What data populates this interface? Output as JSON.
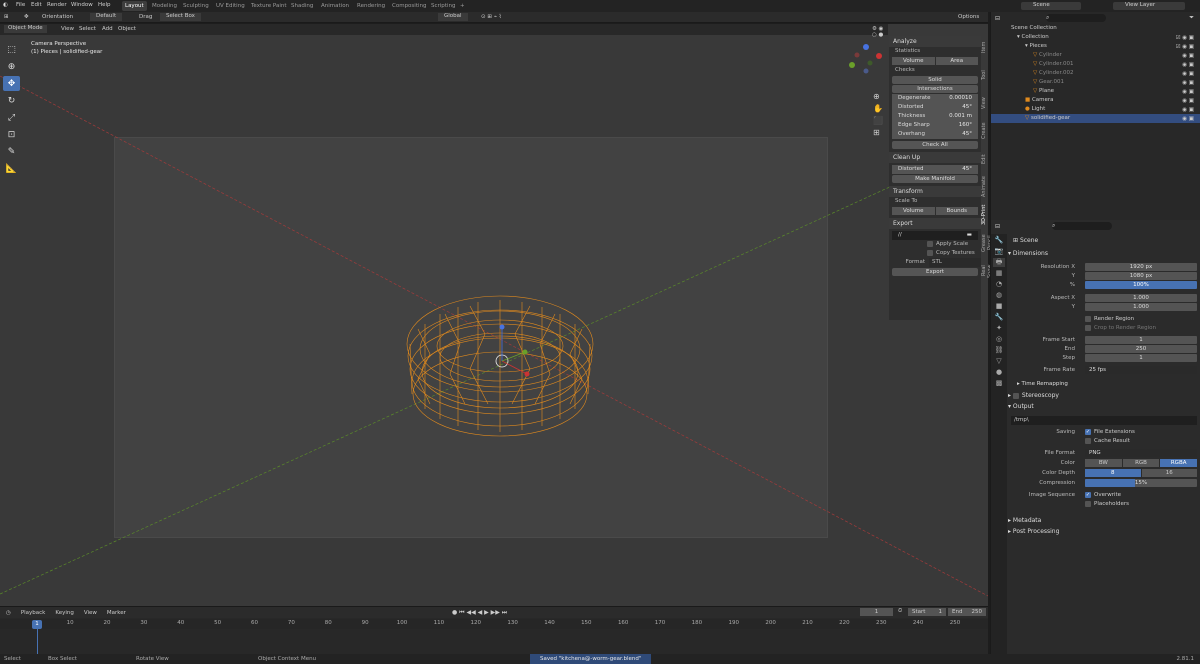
{
  "menu": {
    "file": "File",
    "edit": "Edit",
    "render": "Render",
    "window": "Window",
    "help": "Help"
  },
  "workspaces": [
    "Layout",
    "Modeling",
    "Sculpting",
    "UV Editing",
    "Texture Paint",
    "Shading",
    "Animation",
    "Rendering",
    "Compositing",
    "Scripting"
  ],
  "add_tab": "+",
  "scene": {
    "label": "Scene",
    "view_layer": "View Layer"
  },
  "header": {
    "orientation_label": "Orientation",
    "orientation_value": "Default",
    "drag_label": "Drag",
    "drag_value": "Select Box",
    "transform_orient": "Global",
    "options": "Options"
  },
  "vp_header": {
    "mode": "Object Mode",
    "view": "View",
    "select": "Select",
    "add": "Add",
    "object": "Object"
  },
  "viewport": {
    "camera_text": "Camera Perspective",
    "object_text": "(1) Pieces | solidified-gear"
  },
  "npanel": {
    "analyze": "Analyze",
    "statistics": "Statistics",
    "volume": "Volume",
    "area": "Area",
    "checks": "Checks",
    "solid": "Solid",
    "intersections": "Intersections",
    "rows": [
      {
        "label": "Degenerate",
        "value": "0.00010"
      },
      {
        "label": "Distorted",
        "value": "45°"
      },
      {
        "label": "Thickness",
        "value": "0.001 m"
      },
      {
        "label": "Edge Sharp",
        "value": "160°"
      },
      {
        "label": "Overhang",
        "value": "45°"
      }
    ],
    "check_all": "Check All",
    "cleanup": "Clean Up",
    "distorted": "Distorted",
    "distorted_val": "45°",
    "make_manifold": "Make Manifold",
    "transform": "Transform",
    "scale_to": "Scale To",
    "t_volume": "Volume",
    "bounds": "Bounds",
    "export": "Export",
    "export_path": "//",
    "apply_scale": "Apply Scale",
    "copy_textures": "Copy Textures",
    "format_label": "Format",
    "format_value": "STL",
    "export_btn": "Export"
  },
  "side_tabs": [
    "Item",
    "Tool",
    "View",
    "Create",
    "Edit",
    "Animate",
    "3D-Print",
    "Grease Pencil",
    "Real Snow"
  ],
  "outliner": {
    "scene_collection": "Scene Collection",
    "items": [
      {
        "name": "Collection",
        "indent": 1
      },
      {
        "name": "Pieces",
        "indent": 2
      },
      {
        "name": "Cylinder",
        "indent": 3,
        "dim": true
      },
      {
        "name": "Cylinder.001",
        "indent": 3,
        "dim": true
      },
      {
        "name": "Cylinder.002",
        "indent": 3,
        "dim": true
      },
      {
        "name": "Gear.001",
        "indent": 3,
        "dim": true
      },
      {
        "name": "Plane",
        "indent": 3
      },
      {
        "name": "Camera",
        "indent": 2
      },
      {
        "name": "Light",
        "indent": 2
      },
      {
        "name": "solidified-gear",
        "indent": 2,
        "selected": true
      }
    ]
  },
  "props": {
    "scene": "Scene",
    "dimensions": "Dimensions",
    "res_x_label": "Resolution X",
    "res_x": "1920 px",
    "res_y_label": "Y",
    "res_y": "1080 px",
    "res_pct_label": "%",
    "res_pct": "100%",
    "aspect_x_label": "Aspect X",
    "aspect_x": "1.000",
    "aspect_y_label": "Y",
    "aspect_y": "1.000",
    "render_region": "Render Region",
    "crop_region": "Crop to Render Region",
    "frame_start_label": "Frame Start",
    "frame_start": "1",
    "frame_end_label": "End",
    "frame_end": "250",
    "frame_step_label": "Step",
    "frame_step": "1",
    "frame_rate_label": "Frame Rate",
    "frame_rate": "25 fps",
    "time_remapping": "Time Remapping",
    "stereoscopy": "Stereoscopy",
    "output": "Output",
    "output_path": "/tmp\\",
    "saving": "Saving",
    "file_ext": "File Extensions",
    "cache_result": "Cache Result",
    "file_format_label": "File Format",
    "file_format": "PNG",
    "color_label": "Color",
    "bw": "BW",
    "rgb": "RGB",
    "rgba": "RGBA",
    "color_depth_label": "Color Depth",
    "depth8": "8",
    "depth16": "16",
    "compression_label": "Compression",
    "compression": "15%",
    "compression_fill": 0.15,
    "img_seq": "Image Sequence",
    "overwrite": "Overwrite",
    "placeholders": "Placeholders",
    "metadata": "Metadata",
    "post_processing": "Post Processing"
  },
  "timeline": {
    "playback": "Playback",
    "keying": "Keying",
    "view": "View",
    "marker": "Marker",
    "current": "1",
    "start_label": "Start",
    "start": "1",
    "end_label": "End",
    "end": "250",
    "ticks": [
      "10",
      "20",
      "30",
      "40",
      "50",
      "60",
      "70",
      "80",
      "90",
      "100",
      "110",
      "120",
      "130",
      "140",
      "150",
      "160",
      "170",
      "180",
      "190",
      "200",
      "210",
      "220",
      "230",
      "240",
      "250"
    ],
    "frame": "1"
  },
  "status": {
    "select": "Select",
    "box_select": "Box Select",
    "rotate": "Rotate View",
    "context": "Object Context Menu",
    "saved": "Saved \"kitchena@-worm-gear.blend\"",
    "version": "2.81.1"
  },
  "colors": {
    "accent": "#4772b3",
    "wire": "#e08a1e",
    "axis_x": "#a33a3a",
    "axis_y": "#5a8a2a"
  }
}
